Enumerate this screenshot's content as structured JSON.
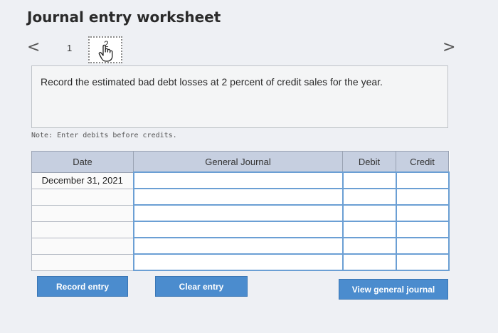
{
  "worksheet": {
    "title": "Journal entry worksheet",
    "nav": {
      "prev": "<",
      "next": ">"
    },
    "steps": [
      "1",
      "2"
    ]
  },
  "prompt": "Record the estimated bad debt losses at 2 percent of credit sales for the year.",
  "note": "Note: Enter debits before credits.",
  "table": {
    "headers": {
      "date": "Date",
      "journal": "General Journal",
      "debit": "Debit",
      "credit": "Credit"
    },
    "rows": [
      {
        "date": "December 31, 2021",
        "account": "",
        "debit": "",
        "credit": ""
      },
      {
        "date": "",
        "account": "",
        "debit": "",
        "credit": ""
      },
      {
        "date": "",
        "account": "",
        "debit": "",
        "credit": ""
      },
      {
        "date": "",
        "account": "",
        "debit": "",
        "credit": ""
      },
      {
        "date": "",
        "account": "",
        "debit": "",
        "credit": ""
      },
      {
        "date": "",
        "account": "",
        "debit": "",
        "credit": ""
      }
    ]
  },
  "buttons": {
    "record": "Record entry",
    "clear": "Clear entry",
    "view": "View general journal"
  },
  "colors": {
    "button": "#4b8cce",
    "header": "#c6cfe0",
    "input_border": "#6b9fd4"
  }
}
